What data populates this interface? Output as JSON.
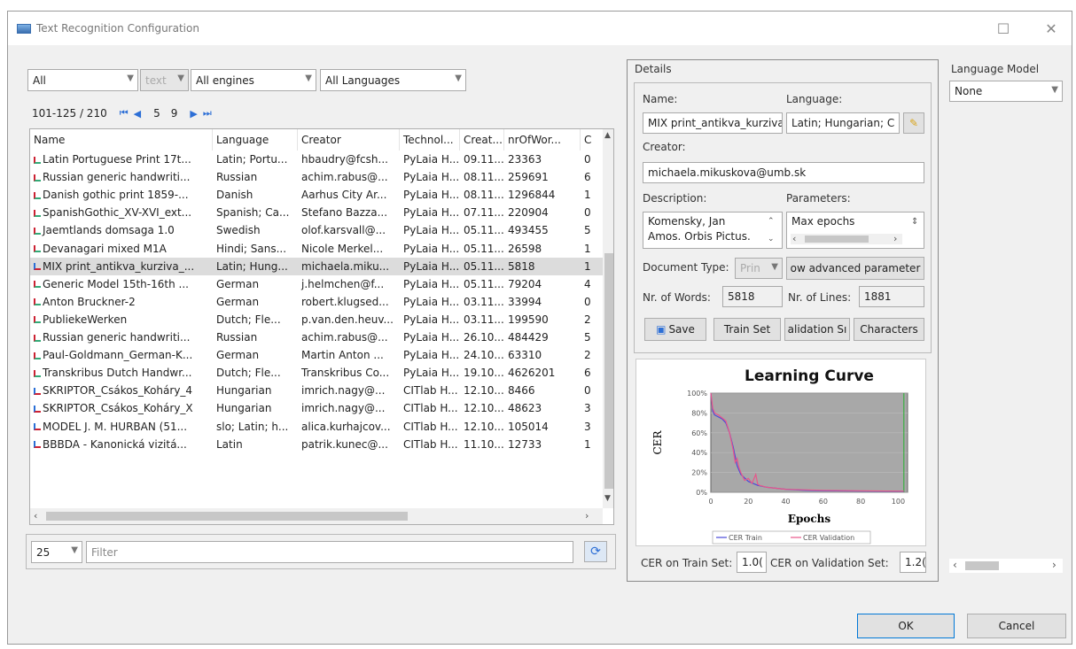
{
  "window": {
    "title": "Text Recognition Configuration",
    "maximize_glyph": "☐",
    "close_glyph": "✕"
  },
  "filters": {
    "scope": "All",
    "text": "text",
    "engine": "All engines",
    "language": "All Languages"
  },
  "pager": {
    "range": "101-125 / 210",
    "page_a": "5",
    "page_b": "9",
    "first": "⏮",
    "prev": "◀",
    "next": "▶",
    "last": "⏭"
  },
  "table": {
    "columns": [
      "Name",
      "Language",
      "Creator",
      "Technol...",
      "Creat...",
      "nrOfWor...",
      "C"
    ],
    "rows": [
      [
        "Latin Portuguese Print 17t...",
        "Latin; Portu...",
        "hbaudry@fcsh...",
        "PyLaia H...",
        "09.11...",
        "23363",
        "0"
      ],
      [
        "Russian generic handwriti...",
        "Russian",
        "achim.rabus@...",
        "PyLaia H...",
        "08.11...",
        "259691",
        "6"
      ],
      [
        "Danish gothic print 1859-...",
        "Danish",
        "Aarhus City Ar...",
        "PyLaia H...",
        "08.11...",
        "1296844",
        "1"
      ],
      [
        "SpanishGothic_XV-XVI_ext...",
        "Spanish; Ca...",
        "Stefano Bazza...",
        "PyLaia H...",
        "07.11...",
        "220904",
        "0"
      ],
      [
        "Jaemtlands domsaga 1.0",
        "Swedish",
        "olof.karsvall@...",
        "PyLaia H...",
        "05.11...",
        "493455",
        "5"
      ],
      [
        "Devanagari mixed M1A",
        "Hindi; Sans...",
        "Nicole Merkel...",
        "PyLaia H...",
        "05.11...",
        "26598",
        "1"
      ],
      [
        "MIX print_antikva_kurziva_...",
        "Latin; Hung...",
        "michaela.miku...",
        "PyLaia H...",
        "05.11...",
        "5818",
        "1"
      ],
      [
        "Generic Model 15th-16th ...",
        "German",
        "j.helmchen@f...",
        "PyLaia H...",
        "05.11...",
        "79204",
        "4"
      ],
      [
        "Anton Bruckner-2",
        "German",
        "robert.klugsed...",
        "PyLaia H...",
        "03.11...",
        "33994",
        "0"
      ],
      [
        "PubliekeWerken",
        "Dutch; Fle...",
        "p.van.den.heuv...",
        "PyLaia H...",
        "03.11...",
        "199590",
        "2"
      ],
      [
        "Russian generic handwriti...",
        "Russian",
        "achim.rabus@...",
        "PyLaia H...",
        "26.10...",
        "484429",
        "5"
      ],
      [
        "Paul-Goldmann_German-K...",
        "German",
        "Martin Anton ...",
        "PyLaia H...",
        "24.10...",
        "63310",
        "2"
      ],
      [
        "Transkribus Dutch Handwr...",
        "Dutch; Fle...",
        "Transkribus Co...",
        "PyLaia H...",
        "19.10...",
        "4626201",
        "6"
      ],
      [
        "SKRIPTOR_Csákos_Koháry_4",
        "Hungarian",
        "imrich.nagy@...",
        "CITlab H...",
        "12.10...",
        "8466",
        "0"
      ],
      [
        "SKRIPTOR_Csákos_Koháry_X",
        "Hungarian",
        "imrich.nagy@...",
        "CITlab H...",
        "12.10...",
        "48623",
        "3"
      ],
      [
        "MODEL J. M. HURBAN (51...",
        "slo; Latin; h...",
        "alica.kurhajcov...",
        "CITlab H...",
        "12.10...",
        "105014",
        "3"
      ],
      [
        "BBBDA - Kanonická vizitá...",
        "Latin",
        "patrik.kunec@...",
        "CITlab H...",
        "11.10...",
        "12733",
        "1"
      ]
    ]
  },
  "bottom": {
    "page_size": "25",
    "filter_placeholder": "Filter"
  },
  "details": {
    "group_label": "Details",
    "name_label": "Name:",
    "name_value": "MIX print_antikva_kurziva",
    "language_label": "Language:",
    "language_value": "Latin; Hungarian; C",
    "creator_label": "Creator:",
    "creator_value": "michaela.mikuskova@umb.sk",
    "description_label": "Description:",
    "description_lines": [
      "Komensky, Jan",
      "Amos. Orbis Pictus."
    ],
    "parameters_label": "Parameters:",
    "parameters_value": "Max epochs",
    "doctype_label": "Document Type:",
    "doctype_value": "Prin",
    "advanced_button": "ow advanced parameter",
    "words_label": "Nr. of Words:",
    "words_value": "5818",
    "lines_label": "Nr. of Lines:",
    "lines_value": "1881",
    "save_button": "Save",
    "trainset_button": "Train Set",
    "validation_button": "alidation Sı",
    "characters_button": "Characters",
    "cer_train_label": "CER on Train Set:",
    "cer_train_value": "1.0(",
    "cer_val_label": "CER on Validation Set:",
    "cer_val_value": "1.2("
  },
  "chart_data": {
    "type": "line",
    "title": "Learning Curve",
    "xlabel": "Epochs",
    "ylabel": "CER",
    "x_ticks": [
      "0",
      "20",
      "40",
      "60",
      "80",
      "100"
    ],
    "y_ticks": [
      "0%",
      "20%",
      "40%",
      "60%",
      "80%",
      "100%"
    ],
    "xlim": [
      0,
      105
    ],
    "ylim": [
      0,
      1.0
    ],
    "series": [
      {
        "name": "CER Train",
        "color": "#4a4ad8",
        "x": [
          0,
          1,
          2,
          4,
          6,
          8,
          10,
          12,
          14,
          16,
          20,
          25,
          30,
          40,
          50,
          60,
          80,
          100,
          103
        ],
        "y": [
          1.0,
          0.82,
          0.78,
          0.76,
          0.74,
          0.7,
          0.6,
          0.45,
          0.27,
          0.18,
          0.11,
          0.07,
          0.05,
          0.03,
          0.02,
          0.015,
          0.012,
          0.01,
          0.01
        ]
      },
      {
        "name": "CER Validation",
        "color": "#e8568a",
        "x": [
          0,
          1,
          2,
          4,
          6,
          8,
          10,
          12,
          13,
          14,
          15,
          16,
          18,
          20,
          22,
          24,
          25,
          26,
          30,
          40,
          60,
          80,
          100,
          103
        ],
        "y": [
          1.0,
          0.85,
          0.8,
          0.78,
          0.75,
          0.72,
          0.6,
          0.42,
          0.3,
          0.34,
          0.25,
          0.2,
          0.12,
          0.14,
          0.09,
          0.18,
          0.08,
          0.07,
          0.05,
          0.03,
          0.02,
          0.015,
          0.012,
          0.012
        ]
      }
    ],
    "marker_x": 103,
    "marker_color": "#3cb043",
    "legend_position": "bottom"
  },
  "language_model": {
    "label": "Language Model",
    "value": "None"
  },
  "footer": {
    "ok": "OK",
    "cancel": "Cancel"
  }
}
